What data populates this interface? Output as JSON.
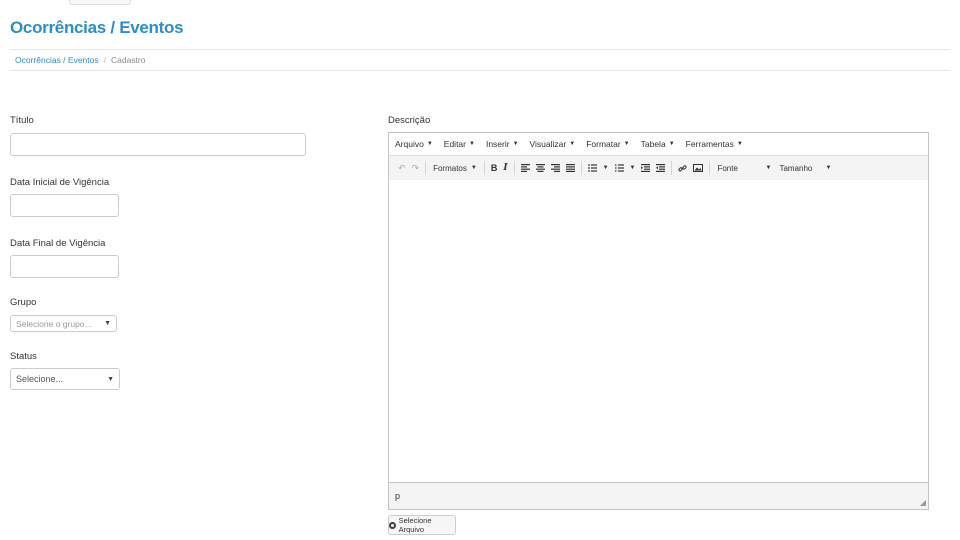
{
  "page": {
    "title": "Ocorrências / Eventos",
    "breadcrumb": {
      "link": "Ocorrências / Eventos",
      "separator": "/",
      "current": "Cadastro"
    }
  },
  "form": {
    "titulo_label": "Título",
    "titulo_value": "",
    "data_inicial_label": "Data Inicial de Vigência",
    "data_inicial_value": "",
    "data_final_label": "Data Final de Vigência",
    "data_final_value": "",
    "grupo_label": "Grupo",
    "grupo_placeholder": "Selecione o grupo...",
    "status_label": "Status",
    "status_placeholder": "Selecione..."
  },
  "editor": {
    "label": "Descrição",
    "menu": [
      "Arquivo",
      "Editar",
      "Inserir",
      "Visualizar",
      "Formatar",
      "Tabela",
      "Ferramentas"
    ],
    "toolbar": {
      "formats": "Formatos",
      "bold": "B",
      "italic": "I",
      "font": "Fonte",
      "size": "Tamanho"
    },
    "status_path": "p",
    "file_button": "Selecione Arquivo"
  },
  "colors": {
    "accent": "#2a8fc9",
    "border": "#cccccc",
    "toolbar_bg": "#f4f4f4"
  }
}
